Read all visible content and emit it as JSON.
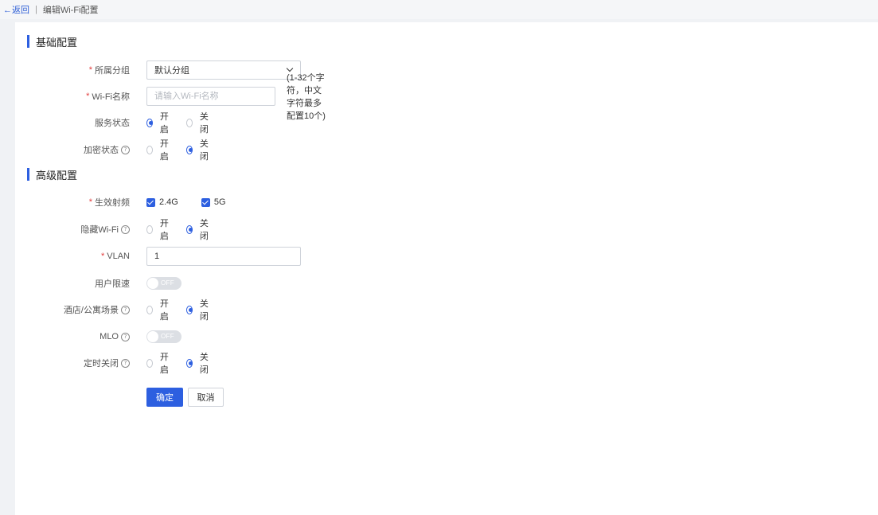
{
  "breadcrumb": {
    "back": "←返回",
    "separator": "|",
    "current": "编辑Wi-Fi配置"
  },
  "sections": {
    "basic": "基础配置",
    "advanced": "高级配置"
  },
  "form": {
    "group": {
      "required": "*",
      "label": "所属分组",
      "value": "默认分组"
    },
    "wifi_name": {
      "required": "*",
      "label": "Wi-Fi名称",
      "placeholder": "请输入Wi-Fi名称",
      "value": "",
      "hint": "(1-32个字符，中文字符最多配置10个)"
    },
    "service_status": {
      "label": "服务状态",
      "options": [
        "开启",
        "关闭"
      ],
      "selected": "开启"
    },
    "encryption_status": {
      "label": "加密状态",
      "help": "?",
      "options": [
        "开启",
        "关闭"
      ],
      "selected": "关闭"
    },
    "radio_band": {
      "required": "*",
      "label": "生效射频",
      "options": [
        "2.4G",
        "5G"
      ],
      "checked": [
        "2.4G",
        "5G"
      ]
    },
    "hide_wifi": {
      "label": "隐藏Wi-Fi",
      "help": "?",
      "options": [
        "开启",
        "关闭"
      ],
      "selected": "关闭"
    },
    "vlan": {
      "required": "*",
      "label": "VLAN",
      "value": "1"
    },
    "user_rate_limit": {
      "label": "用户限速",
      "state": "OFF"
    },
    "hotel_scene": {
      "label": "酒店/公寓场景",
      "help": "?",
      "options": [
        "开启",
        "关闭"
      ],
      "selected": "关闭"
    },
    "mlo": {
      "label": "MLO",
      "help": "?",
      "state": "OFF"
    },
    "timed_off": {
      "label": "定时关闭",
      "help": "?",
      "options": [
        "开启",
        "关闭"
      ],
      "selected": "关闭"
    }
  },
  "actions": {
    "confirm": "确定",
    "cancel": "取消"
  },
  "colors": {
    "primary": "#2d5fe0",
    "required": "#e23b3b",
    "background": "#f0f2f5"
  }
}
